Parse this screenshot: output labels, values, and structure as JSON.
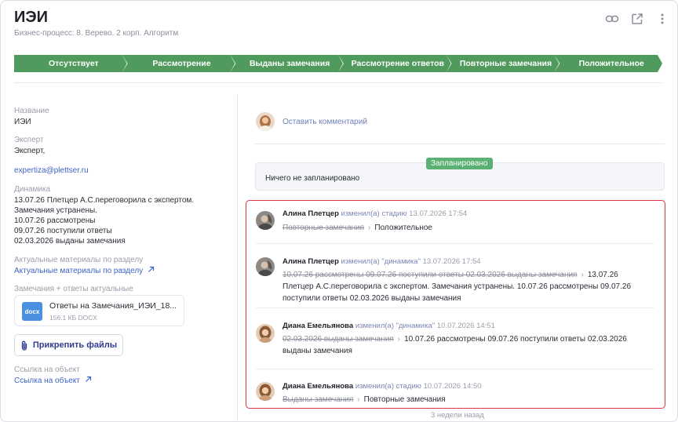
{
  "header": {
    "title": "ИЭИ",
    "subtitle": "Бизнес-процесс: 8. Верево. 2 корп. Алгоритм",
    "icons": [
      "link-icon",
      "open-external-icon",
      "more-vertical-icon"
    ]
  },
  "stages": [
    {
      "label": "Отсутствует"
    },
    {
      "label": "Рассмотрение"
    },
    {
      "label": "Выданы замечания"
    },
    {
      "label": "Рассмотрение ответов"
    },
    {
      "label": "Повторные замечания"
    },
    {
      "label": "Положительное"
    }
  ],
  "fields": {
    "name_label": "Название",
    "name_value": "ИЭИ",
    "expert_label": "Эксперт",
    "expert_value": "Эксперт,",
    "expert_email": "expertiza@plettser.ru",
    "dynamics_label": "Динамика",
    "dynamics_lines": [
      "13.07.26 Плетцер А.С.переговорила с экспертом.",
      "Замечания устранены.",
      "10.07.26 рассмотрены",
      "09.07.26 поступили ответы",
      "02.03.2026 выданы замечания"
    ],
    "materials_label": "Актуальные материалы по разделу",
    "materials_link": "Актуальные материалы по разделу",
    "remarks_label": "Замечания + ответы актуальные",
    "file": {
      "badge": "docx",
      "name": "Ответы на Замечания_ИЭИ_18...",
      "meta": "156.1 КБ DOCX"
    },
    "attach_button": "Прикрепить файлы",
    "object_link_label": "Ссылка на объект",
    "object_link": "Ссылка на объект"
  },
  "activity": {
    "comment_prompt": "Оставить комментарий",
    "planned_badge": "Запланировано",
    "planned_text": "Ничего не запланировано",
    "entries": [
      {
        "author": "Алина Плетцер",
        "action": "изменил(а) стадию",
        "date": "13.07.2026 17:54",
        "old": "Повторные замечания",
        "new": "Положительное"
      },
      {
        "author": "Алина Плетцер",
        "action": "изменил(а) \"динамика\"",
        "date": "13.07.2026 17:54",
        "old": "10.07.26 рассмотрены 09.07.26 поступили ответы 02.03.2026 выданы замечания",
        "new": "13.07.26 Плетцер А.С.переговорила с экспертом. Замечания устранены. 10.07.26 рассмотрены 09.07.26 поступили ответы 02.03.2026 выданы замечания"
      },
      {
        "author": "Диана Емельянова",
        "action": "изменил(а) \"динамика\"",
        "date": "10.07.2026 14:51",
        "old": "02.03.2026 выданы замечания",
        "new": "10.07.26 рассмотрены 09.07.26 поступили ответы 02.03.2026 выданы замечания"
      },
      {
        "author": "Диана Емельянова",
        "action": "изменил(а) стадию",
        "date": "10.07.2026 14:50",
        "old": "Выданы замечания",
        "new": "Повторные замечания"
      }
    ],
    "time_ago": "3 недели назад"
  },
  "colors": {
    "stage_green": "#4f9a5c",
    "badge_green": "#5bb173",
    "link_blue": "#3e63c7",
    "highlight_red": "#d9363e"
  }
}
